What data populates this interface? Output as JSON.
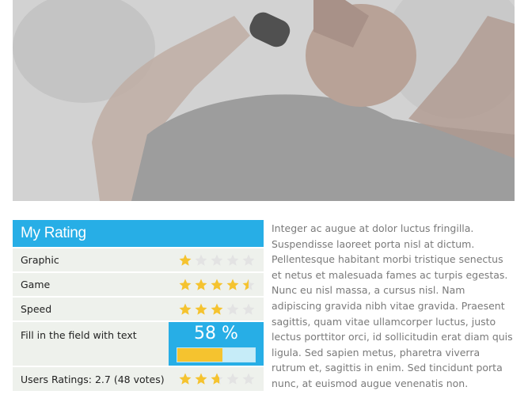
{
  "rating": {
    "title": "My Rating",
    "rows": [
      {
        "label": "Graphic",
        "stars": 1.0
      },
      {
        "label": "Game",
        "stars": 4.5
      },
      {
        "label": "Speed",
        "stars": 3.0
      }
    ],
    "fill": {
      "label": "Fill in the field with text",
      "percent_text": "58 %",
      "percent": 58
    },
    "users": {
      "label": "Users Ratings: 2.7 (48 votes)",
      "stars": 2.7
    }
  },
  "colors": {
    "accent": "#27aee6",
    "star": "#f5c32f",
    "star_empty": "#e3e3e3",
    "row_bg": "#eef1ec"
  },
  "icons": {
    "star": "star-icon"
  },
  "body_text": "Integer ac augue at dolor luctus fringilla. Suspendisse laoreet porta nisl at dictum. Pellentesque habitant morbi tristique senectus et netus et malesuada fames ac turpis egestas. Nunc eu nisl massa, a cursus nisl. Nam adipiscing gravida nibh vitae gravida. Praesent sagittis, quam vitae ullamcorper luctus, justo lectus porttitor orci, id sollicitudin erat diam quis ligula. Sed sapien metus, pharetra viverra rutrum et, sagittis in enim. Sed tincidunt porta nunc, at euismod augue venenatis non."
}
